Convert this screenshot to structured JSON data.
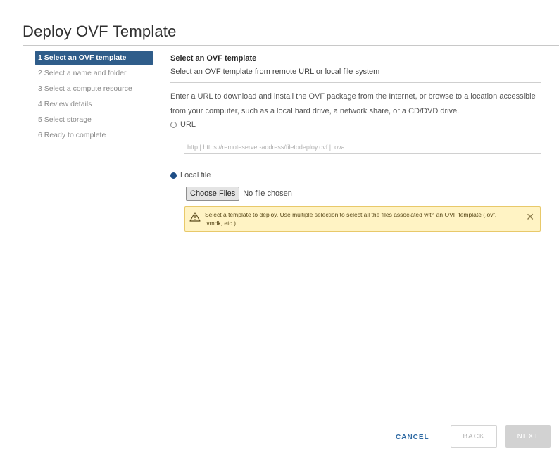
{
  "dialog": {
    "title": "Deploy OVF Template"
  },
  "steps": [
    {
      "label": "1 Select an OVF template",
      "active": true
    },
    {
      "label": "2 Select a name and folder",
      "active": false
    },
    {
      "label": "3 Select a compute resource",
      "active": false
    },
    {
      "label": "4 Review details",
      "active": false
    },
    {
      "label": "5 Select storage",
      "active": false
    },
    {
      "label": "6 Ready to complete",
      "active": false
    }
  ],
  "main": {
    "section_title": "Select an OVF template",
    "section_subtitle": "Select an OVF template from remote URL or local file system",
    "description": "Enter a URL to download and install the OVF package from the Internet, or browse to a location accessible from your computer, such as a local hard drive, a network share, or a CD/DVD drive.",
    "url_option": {
      "label": "URL",
      "selected": false,
      "placeholder": "http | https://remoteserver-address/filetodeploy.ovf | .ova",
      "value": ""
    },
    "local_option": {
      "label": "Local file",
      "selected": true,
      "choose_button_label": "Choose Files",
      "file_status": "No file chosen"
    },
    "alert": {
      "type": "warning",
      "icon": "warning-triangle-icon",
      "text": "Select a template to deploy. Use multiple selection to select all the files associated with an OVF template (.ovf, .vmdk, etc.)",
      "close_icon": "close-icon"
    }
  },
  "footer": {
    "cancel_label": "CANCEL",
    "back_label": "BACK",
    "next_label": "NEXT"
  },
  "colors": {
    "active_step_bg": "#2f5d8a",
    "primary_link": "#2f6aa3",
    "warning_bg": "#fff3c4",
    "warning_border": "#e8c96a",
    "radio_selected": "#1f4e86"
  }
}
